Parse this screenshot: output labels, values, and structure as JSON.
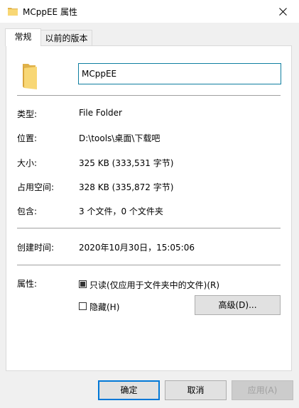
{
  "window": {
    "title": "MCppEE 属性",
    "icon": "folder-icon",
    "close_icon": "close-icon"
  },
  "tabs": [
    {
      "label": "常规",
      "active": true
    },
    {
      "label": "以前的版本",
      "active": false
    }
  ],
  "general": {
    "name_value": "MCppEE",
    "type_label": "类型:",
    "type_value": "File Folder",
    "location_label": "位置:",
    "location_value": "D:\\tools\\桌面\\下载吧",
    "size_label": "大小:",
    "size_value": "325 KB (333,531 字节)",
    "disk_size_label": "占用空间:",
    "disk_size_value": "328 KB (335,872 字节)",
    "contains_label": "包含:",
    "contains_value": "3 个文件，0 个文件夹",
    "created_label": "创建时间:",
    "created_value": "2020年10月30日，15:05:06",
    "attributes_label": "属性:",
    "readonly_label": "只读(仅应用于文件夹中的文件)(R)",
    "readonly_checked": true,
    "hidden_label": "隐藏(H)",
    "hidden_checked": false,
    "advanced_label": "高级(D)..."
  },
  "buttons": {
    "ok": "确定",
    "cancel": "取消",
    "apply": "应用(A)"
  },
  "colors": {
    "folder_yellow": "#f8d775",
    "folder_dark": "#e0b24a",
    "focus_border": "#0078d7",
    "input_border": "#0f7ea0"
  }
}
